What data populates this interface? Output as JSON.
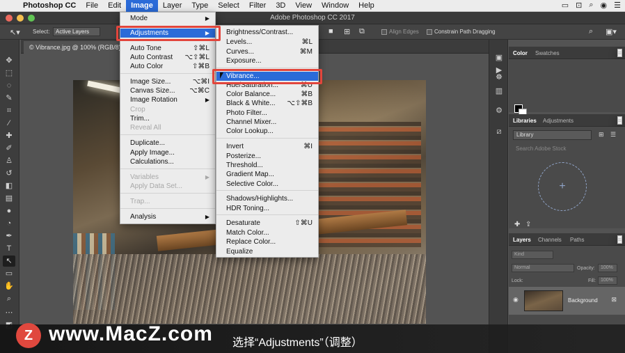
{
  "menubar": {
    "apple": "",
    "items": [
      "Photoshop CC",
      "File",
      "Edit",
      "Image",
      "Layer",
      "Type",
      "Select",
      "Filter",
      "3D",
      "View",
      "Window",
      "Help"
    ],
    "active": "Image"
  },
  "window": {
    "title": "Adobe Photoshop CC 2017"
  },
  "options": {
    "select_label": "Select:",
    "select_value": "Active Layers",
    "align_edges": "Align Edges",
    "constrain": "Constrain Path Dragging"
  },
  "document": {
    "tab": "© Vibrance.jpg @ 100% (RGB/8)"
  },
  "image_menu": {
    "items": [
      {
        "label": "Mode",
        "arrow": "▶"
      },
      {
        "label": "Adjustments",
        "arrow": "▶"
      },
      {
        "label": "Auto Tone",
        "shortcut": "⇧⌘L"
      },
      {
        "label": "Auto Contrast",
        "shortcut": "⌥⇧⌘L"
      },
      {
        "label": "Auto Color",
        "shortcut": "⇧⌘B"
      },
      {
        "label": "Image Size...",
        "shortcut": "⌥⌘I"
      },
      {
        "label": "Canvas Size...",
        "shortcut": "⌥⌘C"
      },
      {
        "label": "Image Rotation",
        "arrow": "▶"
      },
      {
        "label": "Crop"
      },
      {
        "label": "Trim..."
      },
      {
        "label": "Reveal All"
      },
      {
        "label": "Duplicate..."
      },
      {
        "label": "Apply Image..."
      },
      {
        "label": "Calculations..."
      },
      {
        "label": "Variables",
        "arrow": "▶"
      },
      {
        "label": "Apply Data Set..."
      },
      {
        "label": "Trap..."
      },
      {
        "label": "Analysis",
        "arrow": "▶"
      }
    ]
  },
  "adjust_menu": {
    "items": [
      {
        "label": "Brightness/Contrast..."
      },
      {
        "label": "Levels...",
        "shortcut": "⌘L"
      },
      {
        "label": "Curves...",
        "shortcut": "⌘M"
      },
      {
        "label": "Exposure..."
      },
      {
        "label": "Vibrance..."
      },
      {
        "label": "Hue/Saturation...",
        "shortcut": "⌘U"
      },
      {
        "label": "Color Balance...",
        "shortcut": "⌘B"
      },
      {
        "label": "Black & White...",
        "shortcut": "⌥⇧⌘B"
      },
      {
        "label": "Photo Filter..."
      },
      {
        "label": "Channel Mixer..."
      },
      {
        "label": "Color Lookup..."
      },
      {
        "label": "Invert",
        "shortcut": "⌘I"
      },
      {
        "label": "Posterize..."
      },
      {
        "label": "Threshold..."
      },
      {
        "label": "Gradient Map..."
      },
      {
        "label": "Selective Color..."
      },
      {
        "label": "Shadows/Highlights..."
      },
      {
        "label": "HDR Toning..."
      },
      {
        "label": "Desaturate",
        "shortcut": "⇧⌘U"
      },
      {
        "label": "Match Color..."
      },
      {
        "label": "Replace Color..."
      },
      {
        "label": "Equalize"
      }
    ]
  },
  "panels": {
    "color_tabs": [
      "Color",
      "Swatches"
    ],
    "library_tabs": [
      "Libraries",
      "Adjustments"
    ],
    "library_select": "Library",
    "library_search": "Search Adobe Stock",
    "library_add": "+",
    "layers_tabs": [
      "Layers",
      "Channels",
      "Paths"
    ],
    "kind": "Kind",
    "blend": "Normal",
    "opacity_label": "Opacity:",
    "opacity": "100%",
    "lock_label": "Lock:",
    "fill_label": "Fill:",
    "fill": "100%",
    "layer_name": "Background"
  },
  "overlay": {
    "logo": "Z",
    "watermark": "www.MacZ.com",
    "subtitle": "选择“Adjustments”（调整）"
  }
}
